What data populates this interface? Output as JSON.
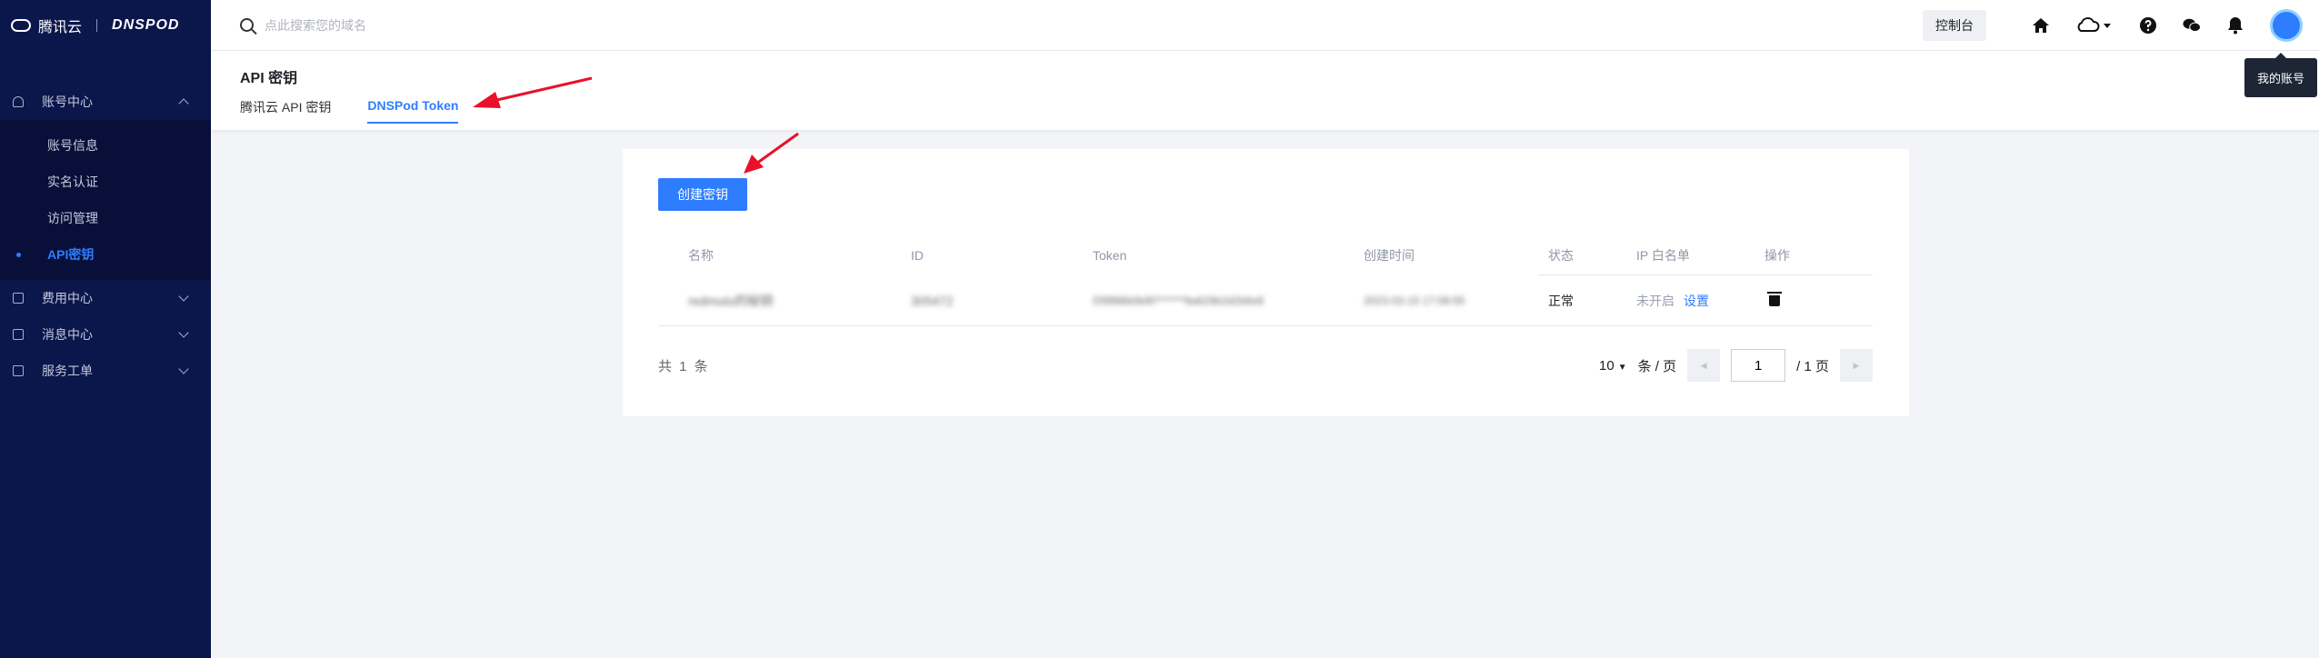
{
  "sidebar": {
    "logo_text": "腾讯云",
    "brand": "DNSPOD",
    "groups": [
      {
        "label": "账号中心",
        "icon": "user-icon",
        "expanded": true
      },
      {
        "label": "费用中心",
        "icon": "wallet-icon"
      },
      {
        "label": "消息中心",
        "icon": "message-icon"
      },
      {
        "label": "服务工单",
        "icon": "ticket-icon"
      }
    ],
    "sub_items": [
      "账号信息",
      "实名认证",
      "访问管理",
      "API密钥"
    ],
    "active_sub": "API密钥"
  },
  "topbar": {
    "search_placeholder": "点此搜索您的域名",
    "console_label": "控制台",
    "tooltip": "我的账号"
  },
  "header": {
    "title": "API 密钥",
    "tabs": [
      "腾讯云 API 密钥",
      "DNSPod Token"
    ],
    "active_tab": "DNSPod Token"
  },
  "card": {
    "create_label": "创建密钥",
    "columns": [
      "名称",
      "ID",
      "Token",
      "创建时间",
      "状态",
      "IP 白名单",
      "操作"
    ],
    "rows": [
      {
        "name": "redmuto的秘钥",
        "id": "305472",
        "token": "f2f8f88b0b9f7******8a629b2d2b6e8",
        "created": "2023-03-15 17:08:55",
        "status": "正常",
        "whitelist": "未开启",
        "whitelist_action": "设置"
      }
    ],
    "total": "共 1 条",
    "page_size": "10",
    "per_page": "条 / 页",
    "page": "1",
    "total_pages": "/ 1 页"
  },
  "colors": {
    "accent": "#2f7dff",
    "sidebar": "#0b164b",
    "annotation": "#e8102a"
  }
}
